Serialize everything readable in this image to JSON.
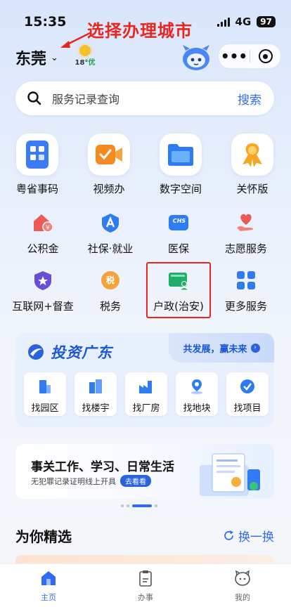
{
  "status_bar": {
    "time": "15:35",
    "network": "4G",
    "battery": "97"
  },
  "annotation": {
    "text": "选择办理城市",
    "color": "#e8261e"
  },
  "header": {
    "city": "东莞",
    "weather_temp": "18°",
    "weather_quality": "优"
  },
  "search": {
    "placeholder": "服务记录查询",
    "button": "搜索"
  },
  "primary_services": [
    {
      "label": "粤省事码",
      "icon": "qr-code-icon"
    },
    {
      "label": "视频办",
      "icon": "video-camera-icon"
    },
    {
      "label": "数字空间",
      "icon": "folder-icon"
    },
    {
      "label": "关怀版",
      "icon": "care-ribbon-icon"
    }
  ],
  "secondary_services": [
    {
      "label": "公积金",
      "icon": "house-fund-icon"
    },
    {
      "label": "社保·就业",
      "icon": "social-security-icon"
    },
    {
      "label": "医保",
      "icon": "medical-insurance-icon",
      "badge": "CHS"
    },
    {
      "label": "志愿服务",
      "icon": "volunteer-heart-icon"
    },
    {
      "label": "互联网+督查",
      "icon": "shield-star-icon"
    },
    {
      "label": "税务",
      "icon": "tax-icon",
      "badge": "税"
    },
    {
      "label": "户政(治安)",
      "icon": "household-registration-icon",
      "highlighted": true
    },
    {
      "label": "更多服务",
      "icon": "more-grid-icon"
    }
  ],
  "invest": {
    "title": "投资广东",
    "slogan": "共发展，赢未来",
    "tiles": [
      {
        "label": "找园区",
        "icon": "park-icon"
      },
      {
        "label": "找楼宇",
        "icon": "building-icon"
      },
      {
        "label": "找厂房",
        "icon": "factory-icon"
      },
      {
        "label": "找地块",
        "icon": "land-pin-icon"
      },
      {
        "label": "找项目",
        "icon": "project-icon"
      }
    ]
  },
  "banner": {
    "headline": "事关工作、学习、日常生活",
    "subtitle": "无犯罪记录证明线上开具",
    "cta": "去看看"
  },
  "featured": {
    "title": "为你精选",
    "refresh": "换一换"
  },
  "tabbar": [
    {
      "label": "主页",
      "icon": "home-icon",
      "active": true
    },
    {
      "label": "办事",
      "icon": "clipboard-icon",
      "active": false
    },
    {
      "label": "我的",
      "icon": "profile-face-icon",
      "active": false
    }
  ],
  "colors": {
    "accent": "#2f6cf6",
    "annotation": "#e8261e",
    "background": "#e3ecfb"
  }
}
